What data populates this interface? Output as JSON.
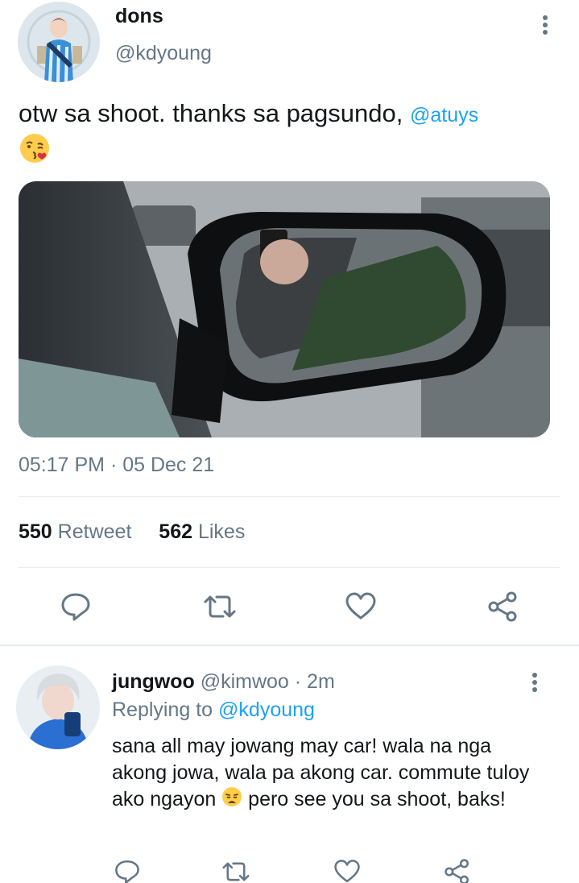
{
  "tweet": {
    "name": "dons",
    "handle": "@kdyoung",
    "text": "otw sa shoot. thanks sa pagsundo, ",
    "mention": "@atuys",
    "emoji": "face-blowing-a-kiss",
    "timestamp": "05:17 PM · 05 Dec 21",
    "retweets": "550",
    "retweets_label": "Retweet",
    "likes": "562",
    "likes_label": "Likes"
  },
  "actions": [
    "reply-icon",
    "retweet-icon",
    "like-icon",
    "share-icon"
  ],
  "reply": {
    "name": "jungwoo",
    "handle": "@kimwoo",
    "separator": " · ",
    "time": "2m",
    "replying_prefix": "Replying to ",
    "replying_to": "@kdyoung",
    "text_before_emoji": "sana all may jowang may car! wala na nga akong jowa, wala pa akong car. commute tuloy ako ngayon ",
    "emoji": "weary-face",
    "text_after_emoji": " pero see you sa shoot, baks!"
  },
  "colors": {
    "accent": "#1da1f2",
    "secondary_text": "#657786",
    "primary_text": "#14171a",
    "divider": "#e6ecf0"
  }
}
